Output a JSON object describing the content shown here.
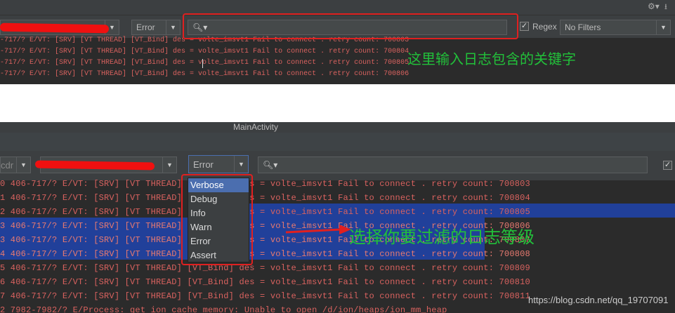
{
  "top": {
    "level_filter": "Error",
    "search_placeholder": "",
    "regex_label": "Regex",
    "regex_checked": true,
    "filter_select": "No Filters",
    "annotation": "这里输入日志包含的关键字",
    "log_lines": [
      "-717/? E/VT: [SRV] [VT THREAD] [VT_Bind] des = volte_imsvt1 Fail to connect . retry count: 700803",
      "-717/? E/VT: [SRV] [VT THREAD] [VT_Bind] des = volte_imsvt1 Fail to connect . retry count: 700804",
      "-717/? E/VT: [SRV] [VT THREAD] [VT_Bind] des = volte_imsvt1 Fail to connect . retry count: 700805",
      "-717/? E/VT: [SRV] [VT THREAD] [VT_Bind] des = volte_imsvt1 Fail to connect . retry count: 700806"
    ]
  },
  "bottom": {
    "tab_title": "MainActivity",
    "device_combo": "cdr",
    "level_filter": "Error",
    "level_options": [
      "Verbose",
      "Debug",
      "Info",
      "Warn",
      "Error",
      "Assert"
    ],
    "highlighted_option": "Verbose",
    "annotation": "选择你要过滤的日志等级",
    "watermark": "https://blog.csdn.net/qq_19707091",
    "log_lines": [
      "0 406-717/? E/VT: [SRV] [VT THREAD] [VT_Bind] des = volte_imsvt1 Fail to connect . retry count: 700803",
      "1 406-717/? E/VT: [SRV] [VT THREAD] [VT_Bind] des = volte_imsvt1 Fail to connect . retry count: 700804",
      "2 406-717/? E/VT: [SRV] [VT THREAD] [VT_Bind] des = volte_imsvt1 Fail to connect . retry count: 700805",
      "3 406-717/? E/VT: [SRV] [VT THREAD] [VT_Bind] des = volte_imsvt1 Fail to connect . retry count: 700806",
      "3 406-717/? E/VT: [SRV] [VT THREAD] [VT_Bind] des = volte_imsvt1 Fail to connect . retry count: 700807",
      "4 406-717/? E/VT: [SRV] [VT THREAD] [VT_Bind] des = volte_imsvt1 Fail to connect . retry count: 700808",
      "5 406-717/? E/VT: [SRV] [VT THREAD] [VT_Bind] des = volte_imsvt1 Fail to connect . retry count: 700809",
      "6 406-717/? E/VT: [SRV] [VT THREAD] [VT_Bind] des = volte_imsvt1 Fail to connect . retry count: 700810",
      "7 406-717/? E/VT: [SRV] [VT THREAD] [VT_Bind] des = volte_imsvt1 Fail to connect . retry count: 700811",
      "2 7982-7982/? E/Process: get ion cache memory: Unable to open /d/ion/heaps/ion_mm_heap"
    ]
  },
  "colors": {
    "accent": "#4b6eaf",
    "selection": "#21409a",
    "log_error": "#d9625f",
    "annotation": "#22c03a",
    "highlight_box": "#e02020"
  }
}
